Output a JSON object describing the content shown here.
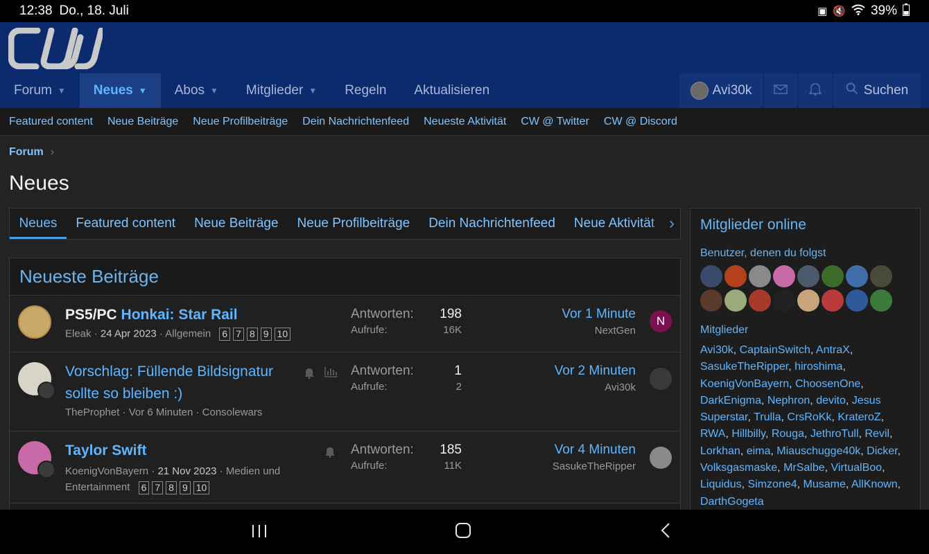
{
  "status_bar": {
    "time": "12:38",
    "date": "Do., 18. Juli",
    "battery": "39%"
  },
  "header": {
    "nav": [
      {
        "label": "Forum",
        "has_caret": true,
        "active": false
      },
      {
        "label": "Neues",
        "has_caret": true,
        "active": true
      },
      {
        "label": "Abos",
        "has_caret": true,
        "active": false
      },
      {
        "label": "Mitglieder",
        "has_caret": true,
        "active": false
      },
      {
        "label": "Regeln",
        "has_caret": false,
        "active": false
      },
      {
        "label": "Aktualisieren",
        "has_caret": false,
        "active": false
      }
    ],
    "username": "Avi30k",
    "search_label": "Suchen"
  },
  "subnav": [
    "Featured content",
    "Neue Beiträge",
    "Neue Profilbeiträge",
    "Dein Nachrichtenfeed",
    "Neueste Aktivität",
    "CW @ Twitter",
    "CW @ Discord"
  ],
  "breadcrumb": "Forum",
  "page_title": "Neues",
  "tabs": [
    "Neues",
    "Featured content",
    "Neue Beiträge",
    "Neue Profilbeiträge",
    "Dein Nachrichtenfeed",
    "Neue Aktivität"
  ],
  "posts": {
    "heading": "Neueste Beiträge",
    "replies_label": "Antworten:",
    "views_label": "Aufrufe:",
    "rows": [
      {
        "prefix": "PS5/PC",
        "title": "Honkai: Star Rail",
        "author": "Eleak",
        "date": "24 Apr 2023",
        "forum": "Allgemein",
        "pages": [
          "6",
          "7",
          "8",
          "9",
          "10"
        ],
        "replies": "198",
        "views": "16K",
        "latest_when": "Vor 1 Minute",
        "latest_user": "NextGen",
        "latest_initial": "N"
      },
      {
        "prefix": "",
        "title": "Vorschlag: Füllende Bildsignatur sollte so bleiben :)",
        "title_line1": "Vorschlag: Füllende Bildsignatur",
        "title_line2": "sollte so bleiben :)",
        "author": "TheProphet",
        "date": "Vor 6 Minuten",
        "forum": "Consolewars",
        "pages": [],
        "replies": "1",
        "views": "2",
        "latest_when": "Vor 2 Minuten",
        "latest_user": "Avi30k",
        "latest_initial": ""
      },
      {
        "prefix": "",
        "title": "Taylor Swift",
        "author": "KoenigVonBayern",
        "date": "21 Nov 2023",
        "forum": "Medien und Entertainment",
        "forum_line1": "Medien und",
        "forum_line2": "Entertainment",
        "pages": [
          "6",
          "7",
          "8",
          "9",
          "10"
        ],
        "replies": "185",
        "views": "11K",
        "latest_when": "Vor 4 Minuten",
        "latest_user": "SasukeTheRipper",
        "latest_initial": ""
      }
    ]
  },
  "sidebar": {
    "title": "Mitglieder online",
    "followed_label": "Benutzer, denen du folgst",
    "followed_colors": [
      "#3a4a6a",
      "#b3411c",
      "#8a8a8a",
      "#c86aa8",
      "#4a5a6a",
      "#3d6b2a",
      "#3f6fa8",
      "#4a4a3a",
      "#5a3a2a",
      "#9aaa7a",
      "#a83a2a",
      "#222222",
      "#c8a47a",
      "#b83a3a",
      "#2f5a9a",
      "#3a7a3a"
    ],
    "members_label": "Mitglieder",
    "members": [
      "Avi30k",
      "CaptainSwitch",
      "AntraX",
      "SasukeTheRipper",
      "hiroshima",
      "KoenigVonBayern",
      "ChoosenOne",
      "DarkEnigma",
      "Nephron",
      "devito",
      "Jesus Superstar",
      "Trulla",
      "CrsRoKk",
      "KraterоZ",
      "RWA",
      "Hillbilly",
      "Rouga",
      "JethroTull",
      "Revil",
      "Lorkhan",
      "eima",
      "Miauschugge40k",
      "Dicker",
      "Volksgasmaske",
      "MrSalbe",
      "VirtualBoo",
      "Liquidus",
      "Simzone4",
      "Musame",
      "AllKnown",
      "DarthGogeta"
    ]
  },
  "colors": {
    "header_bg": "#0c2a6e",
    "accent": "#5db6ff",
    "page_bg": "#232323"
  },
  "icons": {
    "notify": "bell-icon",
    "stats": "bar-chart-icon",
    "mail": "envelope-icon",
    "alerts": "bell-icon",
    "search": "search-icon",
    "next": "chevron-right-icon"
  }
}
